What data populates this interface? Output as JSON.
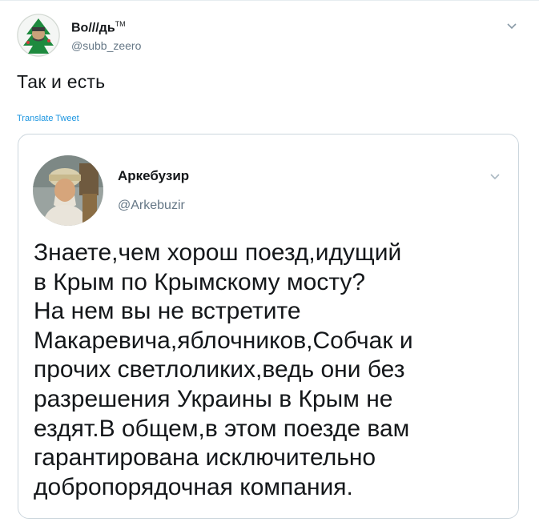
{
  "author": {
    "name": "Bo///дь",
    "tm": "TM",
    "handle": "@subb_zeero"
  },
  "tweet": {
    "text": "Так и есть",
    "translate_label": "Translate Tweet"
  },
  "quoted": {
    "name": "Аркебузир",
    "handle": "@Arkebuzir",
    "lines": [
      "Знаете,чем хорош поезд,идущий",
      "в Крым по Крымскому мосту?",
      "На нем вы не встретите",
      "Макаревича,яблочников,Собчак и",
      "прочих светлоликих,ведь они без",
      "разрешения Украины в Крым не",
      "ездят.В общем,в этом поезде вам",
      "гарантирована исключительно",
      "добропорядочная компания."
    ]
  },
  "icons": {
    "menu": "chevron-down-icon"
  },
  "colors": {
    "text": "#14171a",
    "secondary": "#657786",
    "link": "#1b95e0",
    "border": "#ccd6dd"
  }
}
